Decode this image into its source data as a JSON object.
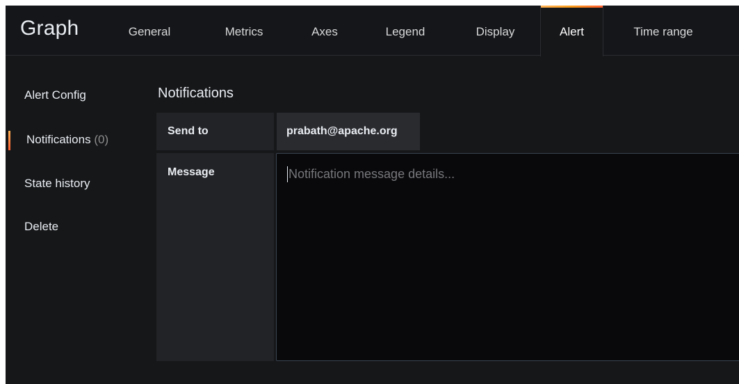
{
  "panel": {
    "title": "Graph"
  },
  "tabs": [
    {
      "label": "General",
      "active": false
    },
    {
      "label": "Metrics",
      "active": false
    },
    {
      "label": "Axes",
      "active": false
    },
    {
      "label": "Legend",
      "active": false
    },
    {
      "label": "Display",
      "active": false
    },
    {
      "label": "Alert",
      "active": true
    },
    {
      "label": "Time range",
      "active": false
    }
  ],
  "subnav": {
    "items": [
      {
        "label": "Alert Config",
        "count": null,
        "active": false
      },
      {
        "label": "Notifications",
        "count": "(0)",
        "active": true
      },
      {
        "label": "State history",
        "count": null,
        "active": false
      },
      {
        "label": "Delete",
        "count": null,
        "active": false
      }
    ]
  },
  "notifications": {
    "title": "Notifications",
    "send_to_label": "Send to",
    "send_to_value": "prabath@apache.org",
    "message_label": "Message",
    "message_value": "",
    "message_placeholder": "Notification message details..."
  },
  "colors": {
    "background": "#161719",
    "accent_gradient_start": "#ffb357",
    "accent_gradient_end": "#ff5d2f",
    "label_cell": "#222326",
    "input_background": "#09090b"
  }
}
